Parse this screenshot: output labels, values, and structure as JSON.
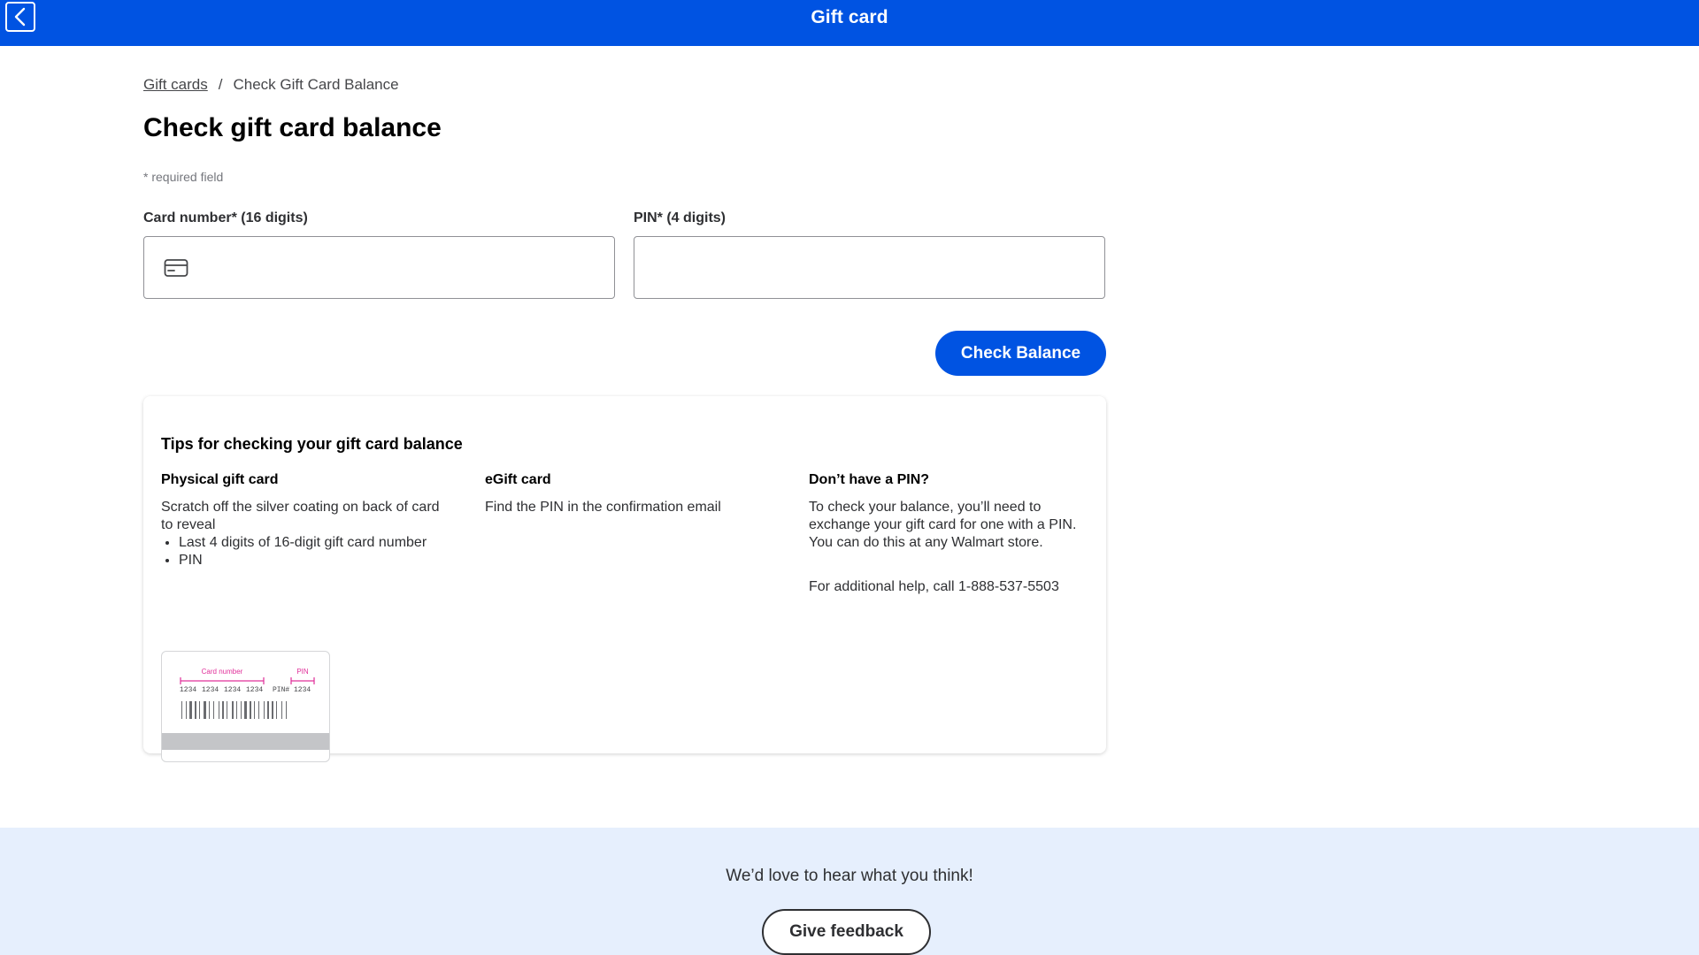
{
  "header": {
    "title": "Gift card",
    "back_icon": "chevron-left-icon",
    "background": "#0053e2"
  },
  "breadcrumb": {
    "items": [
      "Gift cards",
      "Check Gift Card Balance"
    ],
    "separator": "/"
  },
  "page": {
    "title": "Check gift card balance",
    "required_note": "* required field"
  },
  "form": {
    "card_number": {
      "label": "Card number* (16 digits)",
      "value": "",
      "icon": "credit-card-icon"
    },
    "pin": {
      "label": "PIN* (4 digits)",
      "value": ""
    },
    "submit_label": "Check Balance",
    "accent": "#0053e2"
  },
  "tips": {
    "title": "Tips for checking your gift card balance",
    "physical": {
      "heading": "Physical gift card",
      "text": "Scratch off the silver coating on back of card to reveal",
      "bullets": [
        "Last 4 digits of 16-digit gift card number",
        "PIN"
      ]
    },
    "egift": {
      "heading": "eGift card",
      "text": "Find the PIN in the confirmation email"
    },
    "no_pin": {
      "heading": "Don’t have a PIN?",
      "text": "To check your balance, you’ll need to exchange your gift card for one with a PIN. You can do this at any Walmart store.",
      "help": "For additional help, call 1-888-537-5503"
    },
    "card_image": {
      "card_number_label": "Card number",
      "pin_label": "PIN",
      "digits": [
        "1234",
        "1234",
        "1234",
        "1234"
      ],
      "pin_digits": "PIN# 1234"
    }
  },
  "feedback": {
    "text": "We’d love to hear what you think!",
    "button_label": "Give feedback",
    "background": "#e6effd"
  }
}
